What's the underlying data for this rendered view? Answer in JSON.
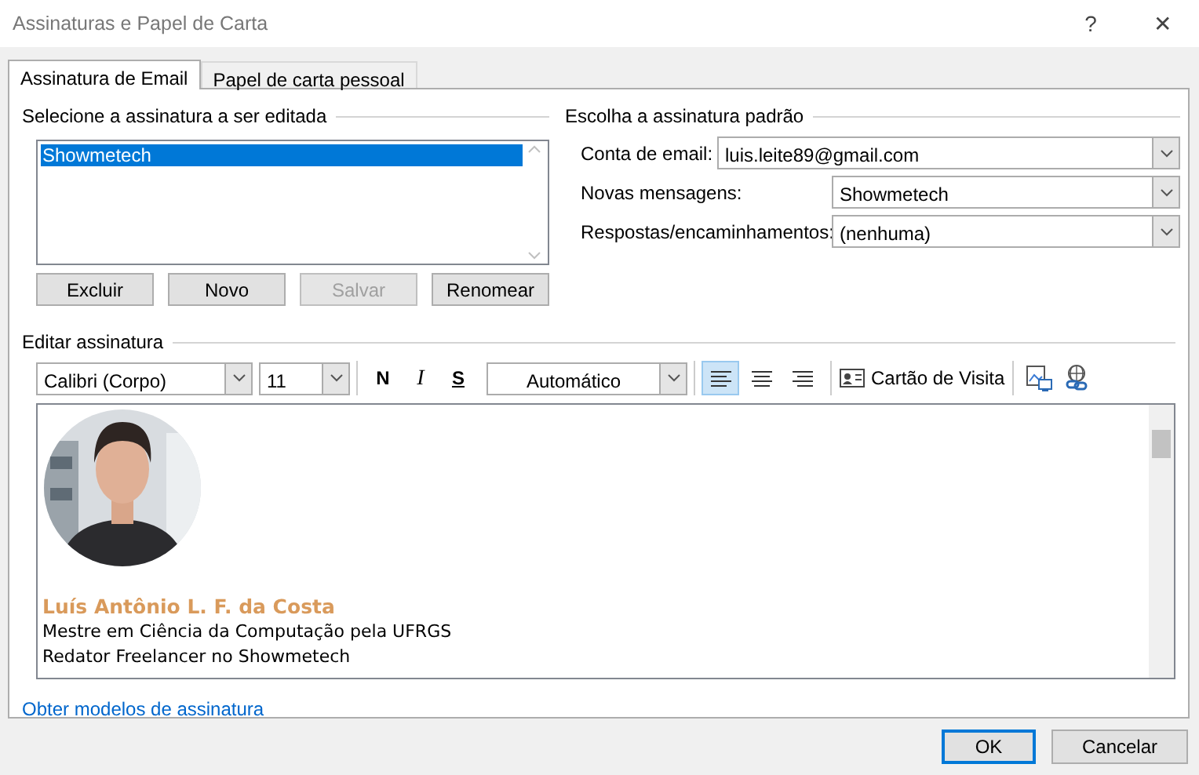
{
  "window": {
    "title": "Assinaturas e Papel de Carta",
    "help": "?",
    "close": "✕"
  },
  "tabs": [
    {
      "label": "Assinatura de Email",
      "selected": true
    },
    {
      "label": "Papel de carta pessoal",
      "selected": false
    }
  ],
  "signature_list": {
    "heading": "Selecione a assinatura a ser editada",
    "items": [
      {
        "label": "Showmetech",
        "selected": true
      }
    ]
  },
  "list_buttons": [
    {
      "label": "Excluir",
      "disabled": false
    },
    {
      "label": "Novo",
      "disabled": false
    },
    {
      "label": "Salvar",
      "disabled": true
    },
    {
      "label": "Renomear",
      "disabled": false
    }
  ],
  "default_signature": {
    "heading": "Escolha a assinatura padrão",
    "fields": [
      {
        "label": "Conta de email:",
        "value": "luis.leite89@gmail.com",
        "wide": true
      },
      {
        "label": "Novas mensagens:",
        "value": "Showmetech",
        "wide": false
      },
      {
        "label": "Respostas/encaminhamentos:",
        "value": "(nenhuma)",
        "wide": false
      }
    ]
  },
  "editor": {
    "heading": "Editar assinatura",
    "font": "Calibri (Corpo)",
    "size": "11",
    "bold": "N",
    "italic": "I",
    "underline": "S",
    "font_color": "Automático",
    "align": [
      {
        "kind": "left",
        "selected": true
      },
      {
        "kind": "center",
        "selected": false
      },
      {
        "kind": "right",
        "selected": false
      }
    ],
    "business_card": "Cartão de Visita",
    "content": {
      "picture": {
        "kind": "picture"
      },
      "name": "Luís Antônio L. F. da Costa",
      "lines": [
        "Mestre em Ciência da Computação pela UFRGS",
        "Redator Freelancer no Showmetech"
      ]
    }
  },
  "link": "Obter modelos de assinatura",
  "footer_buttons": [
    {
      "label": "OK",
      "default": true
    },
    {
      "label": "Cancelar",
      "default": false
    }
  ]
}
